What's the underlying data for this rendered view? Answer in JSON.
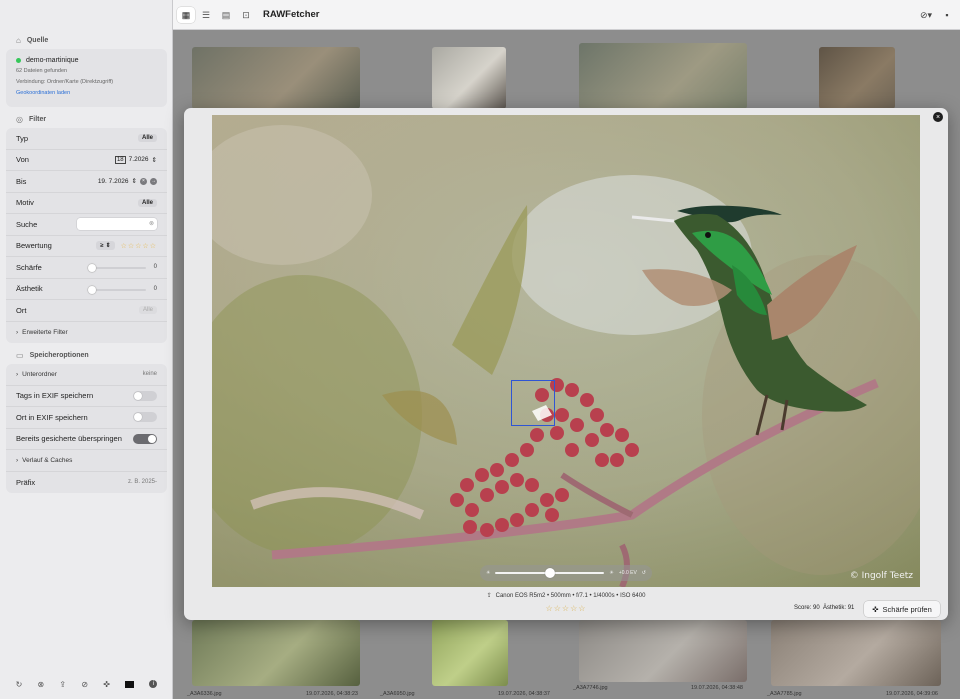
{
  "window": {
    "title": "RAWFetcher"
  },
  "toolbar": {
    "view_icons": [
      "grid-icon",
      "list-icon",
      "image-icon",
      "import-icon"
    ],
    "right_icons": [
      "check-menu-icon",
      "chat-icon"
    ]
  },
  "sidebar": {
    "source": {
      "heading": "Quelle",
      "name": "demo-martinique",
      "files_found": "62 Dateien gefunden",
      "connection": "Verbindung: Ordner/Karte (Direktzugriff)",
      "geo_link": "Geokoordinaten laden"
    },
    "filter": {
      "heading": "Filter",
      "typ_label": "Typ",
      "typ_value": "Alle",
      "von_label": "Von",
      "von_value": "7.2026",
      "bis_label": "Bis",
      "bis_value": "19.  7.2026",
      "motiv_label": "Motiv",
      "motiv_value": "Alle",
      "suche_label": "Suche",
      "suche_value": "",
      "bewertung_label": "Bewertung",
      "bewertung_op": "≥",
      "schaerfe_label": "Schärfe",
      "schaerfe_value": "0",
      "schaerfe_level": 0,
      "aesthetik_label": "Ästhetik",
      "aesthetik_value": "0",
      "aesthetik_level": 0,
      "ort_label": "Ort",
      "ort_value": "Alle",
      "advanced": "Erweiterte Filter"
    },
    "storage": {
      "heading": "Speicheroptionen",
      "subfolder_label": "Unterordner",
      "subfolder_value": "keine",
      "tags_exif": "Tags in EXIF speichern",
      "tags_exif_on": false,
      "ort_exif": "Ort in EXIF speichern",
      "ort_exif_on": false,
      "skip_saved": "Bereits gesicherte überspringen",
      "skip_saved_on": true,
      "history": "Verlauf & Caches",
      "prefix_label": "Präfix",
      "prefix_placeholder": "z. B. 2025-"
    },
    "bottom_icons": [
      "refresh-icon",
      "cancel-icon",
      "export-icon",
      "compass-icon",
      "focus-icon",
      "square-icon",
      "info-icon"
    ]
  },
  "grid": {
    "items": [
      {
        "file": "_A3A6336.jpg",
        "date": "19.07.2026, 04:38:23"
      },
      {
        "file": "_A3A6950.jpg",
        "date": "19.07.2026, 04:38:37"
      },
      {
        "file": "_A3A7746.jpg",
        "date": "19.07.2026, 04:38:48"
      },
      {
        "file": "_A3A7785.jpg",
        "date": "19.07.2026, 04:39:06"
      }
    ]
  },
  "viewer": {
    "copyright": "© Ingolf Teetz",
    "exposure": "+0.0 EV",
    "camera": "Canon EOS R5m2 • 500mm • f/7.1 • 1/4000s • ISO 6400",
    "rating_stars": 0,
    "score": "Score: 90",
    "aesthetic": "Ästhetik: 91",
    "sharpness_button": "Schärfe prüfen"
  }
}
